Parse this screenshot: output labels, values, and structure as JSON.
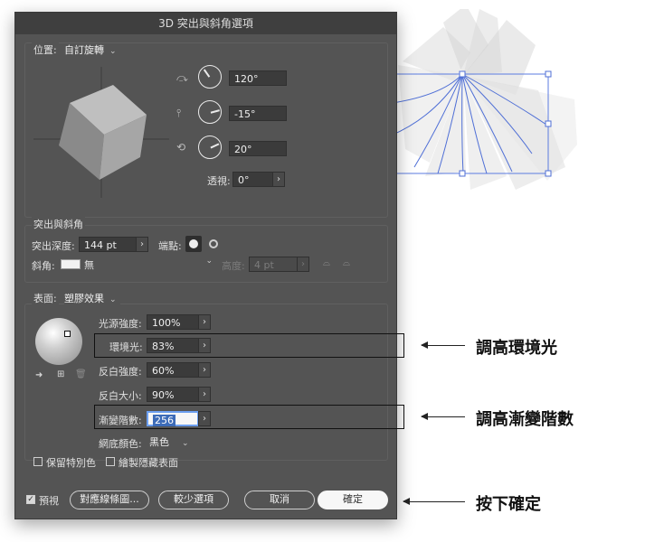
{
  "dialog": {
    "title": "3D 突出與斜角選項"
  },
  "position": {
    "label": "位置:",
    "preset": "自訂旋轉",
    "x_angle": "120°",
    "y_angle": "-15°",
    "z_angle": "20°",
    "perspective_label": "透視:",
    "perspective": "0°"
  },
  "extrude": {
    "section_label": "突出與斜角",
    "depth_label": "突出深度:",
    "depth": "144 pt",
    "cap_label": "端點:",
    "bevel_label": "斜角:",
    "bevel": "無",
    "height_label": "高度:",
    "height": "4 pt"
  },
  "surface": {
    "label": "表面:",
    "type": "塑膠效果",
    "light_intensity_label": "光源強度:",
    "light_intensity": "100%",
    "ambient_label": "環境光:",
    "ambient": "83%",
    "highlight_intensity_label": "反白強度:",
    "highlight_intensity": "60%",
    "highlight_size_label": "反白大小:",
    "highlight_size": "90%",
    "blend_steps_label": "漸變階數:",
    "blend_steps": "256",
    "shading_color_label": "網底顏色:",
    "shading_color": "黑色"
  },
  "checkboxes": {
    "preserve_spot": "保留特別色",
    "draw_hidden": "繪製隱藏表面",
    "preview": "預視"
  },
  "buttons": {
    "map_art": "對應線條圖...",
    "fewer_options": "較少選項",
    "cancel": "取消",
    "ok": "確定"
  },
  "annotations": {
    "ambient": "調高環境光",
    "blend_steps": "調高漸變階數",
    "press_ok": "按下確定"
  },
  "colors": {
    "dialog_bg": "#545454",
    "selection": "#3c6bb8",
    "path_blue": "#4f6fd6"
  }
}
